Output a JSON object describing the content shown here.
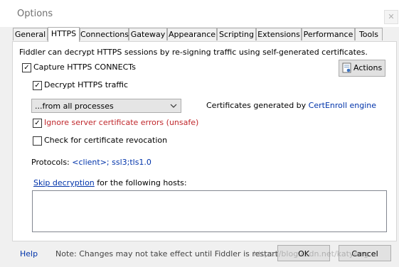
{
  "window": {
    "title": "Options",
    "close_glyph": "✕"
  },
  "tabs": [
    {
      "label": "General"
    },
    {
      "label": "HTTPS"
    },
    {
      "label": "Connections"
    },
    {
      "label": "Gateway"
    },
    {
      "label": "Appearance"
    },
    {
      "label": "Scripting"
    },
    {
      "label": "Extensions"
    },
    {
      "label": "Performance"
    },
    {
      "label": "Tools"
    }
  ],
  "active_tab": "HTTPS",
  "https": {
    "description": "Fiddler can decrypt HTTPS sessions by re-signing traffic using self-generated certificates.",
    "capture_label": "Capture HTTPS CONNECTs",
    "capture_checked": true,
    "actions_label": "Actions",
    "decrypt_label": "Decrypt HTTPS traffic",
    "decrypt_checked": true,
    "process_filter_value": "...from all processes",
    "cert_text": "Certificates generated by",
    "cert_engine_link": "CertEnroll engine",
    "ignore_errors_label": "Ignore server certificate errors (unsafe)",
    "ignore_errors_checked": true,
    "revocation_label": "Check for certificate revocation",
    "revocation_checked": false,
    "protocols_label": "Protocols:",
    "protocols_value": "<client>; ssl3;tls1.0",
    "skip_link": "Skip decryption",
    "skip_text": "for the following hosts:",
    "hosts_value": ""
  },
  "footer": {
    "help_label": "Help",
    "note": "Note: Changes may not take effect until Fiddler is restarted.",
    "ok_label": "OK",
    "cancel_label": "Cancel",
    "watermark": "https://blog.csdn.net/katyeng"
  },
  "colors": {
    "link": "#0033aa",
    "warning_text": "#c0282d",
    "panel_bg": "#ffffff",
    "window_bg": "#f0f0f0"
  }
}
